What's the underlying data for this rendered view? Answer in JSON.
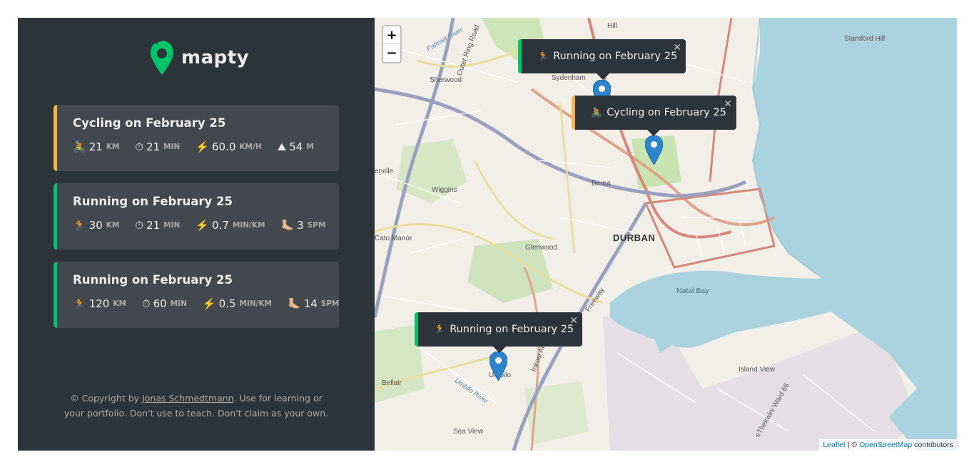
{
  "brand": {
    "name": "mapty"
  },
  "workouts": [
    {
      "type": "cycling",
      "title": "Cycling on February 25",
      "details": [
        {
          "icon": "🚴",
          "value": "21",
          "unit": "km"
        },
        {
          "icon": "⏱",
          "value": "21",
          "unit": "min"
        },
        {
          "icon": "⚡️",
          "value": "60.0",
          "unit": "km/h"
        },
        {
          "icon": "⛰",
          "value": "54",
          "unit": "m"
        }
      ]
    },
    {
      "type": "running",
      "title": "Running on February 25",
      "details": [
        {
          "icon": "🏃",
          "value": "30",
          "unit": "km"
        },
        {
          "icon": "⏱",
          "value": "21",
          "unit": "min"
        },
        {
          "icon": "⚡️",
          "value": "0.7",
          "unit": "min/km"
        },
        {
          "icon": "🦶🏼",
          "value": "3",
          "unit": "spm"
        }
      ]
    },
    {
      "type": "running",
      "title": "Running on February 25",
      "details": [
        {
          "icon": "🏃",
          "value": "120",
          "unit": "km"
        },
        {
          "icon": "⏱",
          "value": "60",
          "unit": "min"
        },
        {
          "icon": "⚡️",
          "value": "0.5",
          "unit": "min/km"
        },
        {
          "icon": "🦶🏼",
          "value": "14",
          "unit": "spm"
        }
      ]
    }
  ],
  "copyright": {
    "prefix": "© Copyright by ",
    "author": "Jonas Schmedtmann",
    "suffix": ". Use for learning or your portfolio. Don't use to teach. Don't claim as your own."
  },
  "map": {
    "zoom_in": "+",
    "zoom_out": "−",
    "close": "✕",
    "popups": [
      {
        "icon": "🏃",
        "text": "Running on February 25",
        "type": "running"
      },
      {
        "icon": "🚴",
        "text": "Cycling on February 25",
        "type": "cycling"
      },
      {
        "icon": "🏃",
        "text": "Running on February 25",
        "type": "running"
      }
    ],
    "labels": {
      "durban": "DURBAN",
      "natal_bay": "Natal Bay",
      "sydenham": "Sydenham",
      "sherwood": "Sherwood",
      "wiggins": "Wiggins",
      "berea": "Berea",
      "glenwood": "Glenwood",
      "cato_manor": "Cato Manor",
      "bellair": "Bellair",
      "sea_view": "Sea View",
      "umbilo": "Umbilo",
      "umbilo_river": "Umbilo River",
      "island_view": "Island View",
      "stamford": "Stamford Hill",
      "westville": "erville",
      "outer_ring": "Outer Ring Road",
      "freeway": "Freeway",
      "inkosi": "Inkosi Albert",
      "ward": "eThekwini Ward 66",
      "palmiet": "Palmiet River",
      "hill": "Hill"
    },
    "attribution": {
      "leaflet": "Leaflet",
      "sep": " | © ",
      "osm": "OpenStreetMap",
      "tail": " contributors"
    }
  },
  "colors": {
    "sidebar_bg": "#2d3439",
    "card_bg": "#42484d",
    "running": "#00c46a",
    "cycling": "#ffb545",
    "water": "#aad3df"
  }
}
